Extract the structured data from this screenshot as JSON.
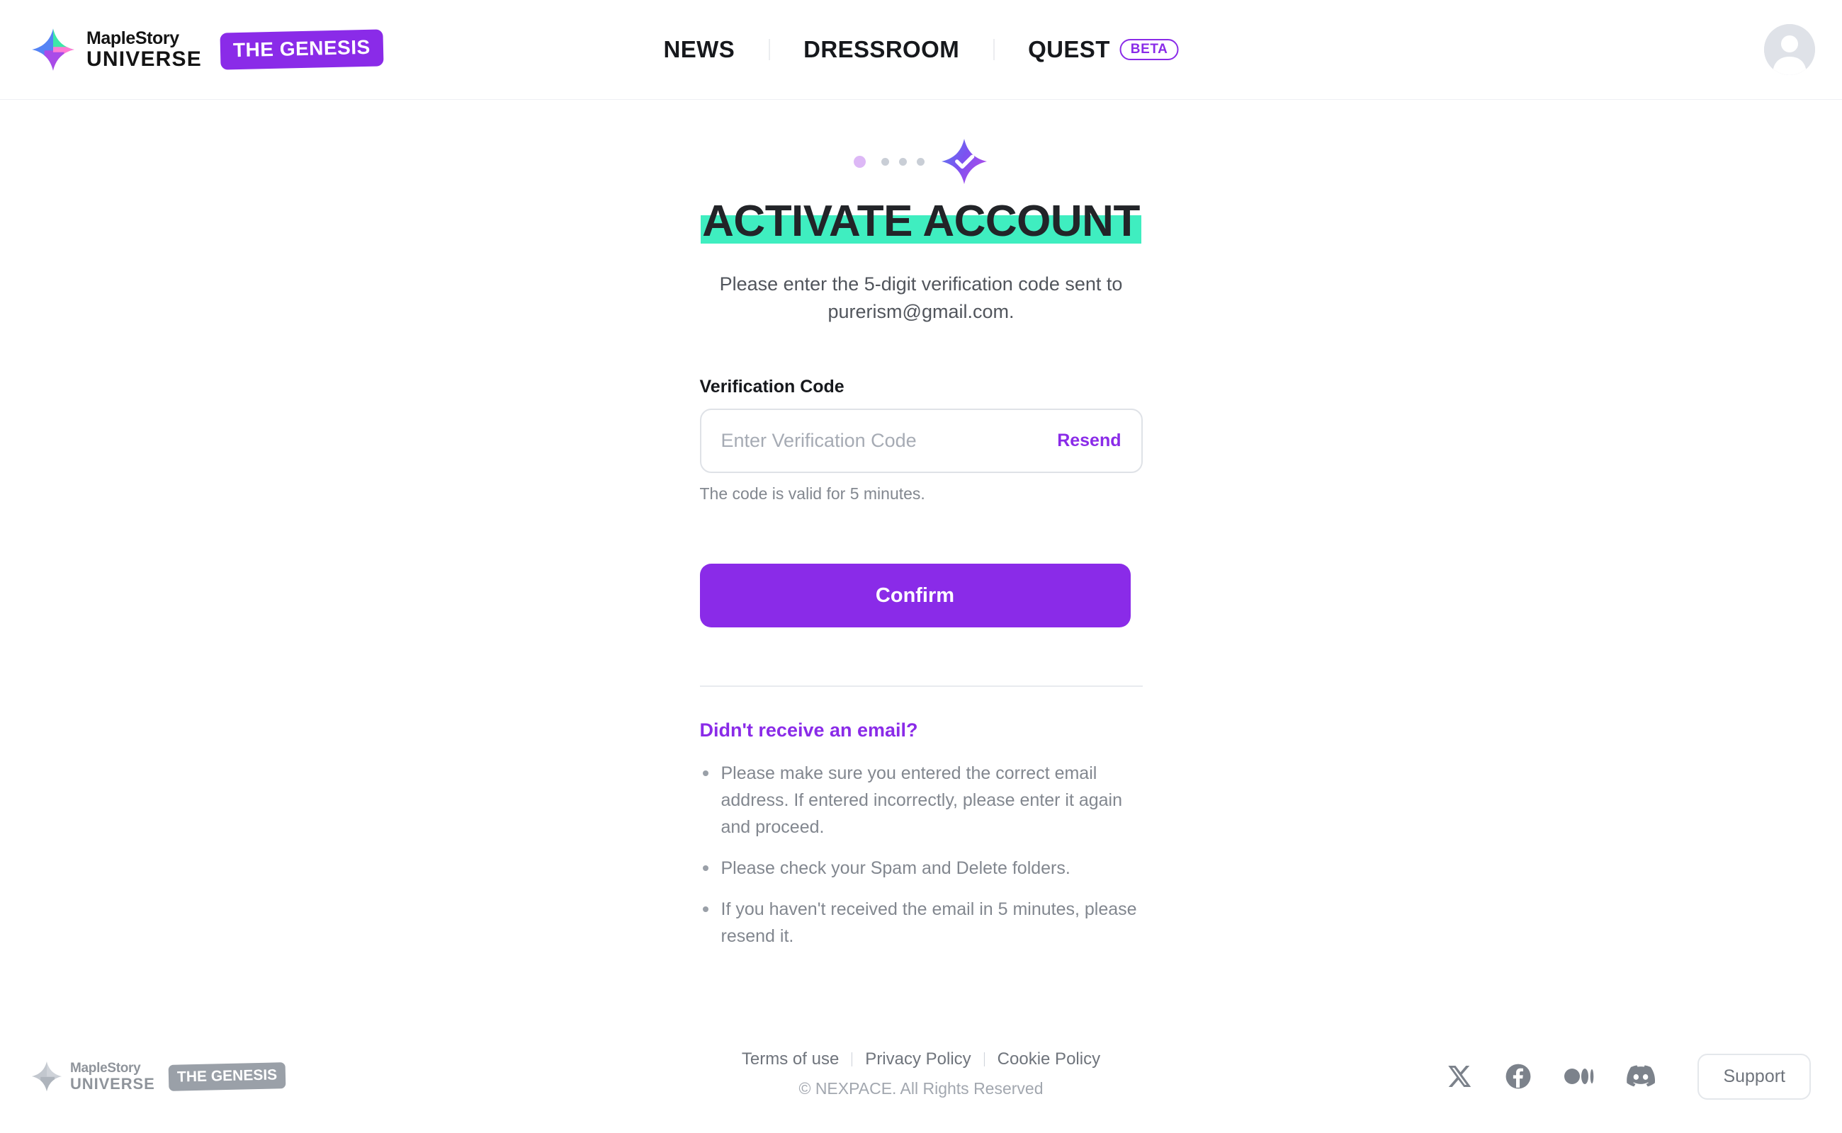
{
  "header": {
    "brand": {
      "maple": "MapleStory",
      "universe": "UNIVERSE",
      "genesis_badge": "THE GENESIS",
      "star_icon": "maplestory-star-logo"
    },
    "nav": [
      {
        "label": "NEWS",
        "badge": null
      },
      {
        "label": "DRESSROOM",
        "badge": null
      },
      {
        "label": "QUEST",
        "badge": "BETA"
      }
    ],
    "avatar_icon": "user-avatar-placeholder"
  },
  "main": {
    "progress": {
      "current_dot": "active",
      "pending_dots": 3,
      "star_icon": "check-star-icon"
    },
    "title": "ACTIVATE ACCOUNT",
    "subtitle": "Please enter the 5-digit verification code sent to purerism@gmail.com.",
    "form": {
      "label": "Verification Code",
      "input_value": "",
      "input_placeholder": "Enter Verification Code",
      "resend_label": "Resend",
      "helper_text": "The code is valid for 5 minutes.",
      "confirm_label": "Confirm"
    },
    "help": {
      "title": "Didn't receive an email?",
      "items": [
        "Please make sure you entered the correct email address. If entered incorrectly, please enter it again and proceed.",
        "Please check your Spam and Delete folders.",
        "If you haven't received the email in 5 minutes, please resend it."
      ]
    }
  },
  "footer": {
    "brand": {
      "maple": "MapleStory",
      "universe": "UNIVERSE",
      "genesis_badge": "THE GENESIS",
      "star_icon": "maplestory-star-logo-gray"
    },
    "links": [
      {
        "label": "Terms of use"
      },
      {
        "label": "Privacy Policy"
      },
      {
        "label": "Cookie Policy"
      }
    ],
    "copyright": "© NEXPACE. All Rights Reserved",
    "social": [
      {
        "name": "x-twitter-icon"
      },
      {
        "name": "facebook-icon"
      },
      {
        "name": "medium-icon"
      },
      {
        "name": "discord-icon"
      }
    ],
    "support_label": "Support"
  },
  "colors": {
    "accent_purple": "#8A2BE8",
    "highlight_mint": "#3FEEC0",
    "text_dark": "#16181c",
    "text_muted": "#82878f"
  }
}
